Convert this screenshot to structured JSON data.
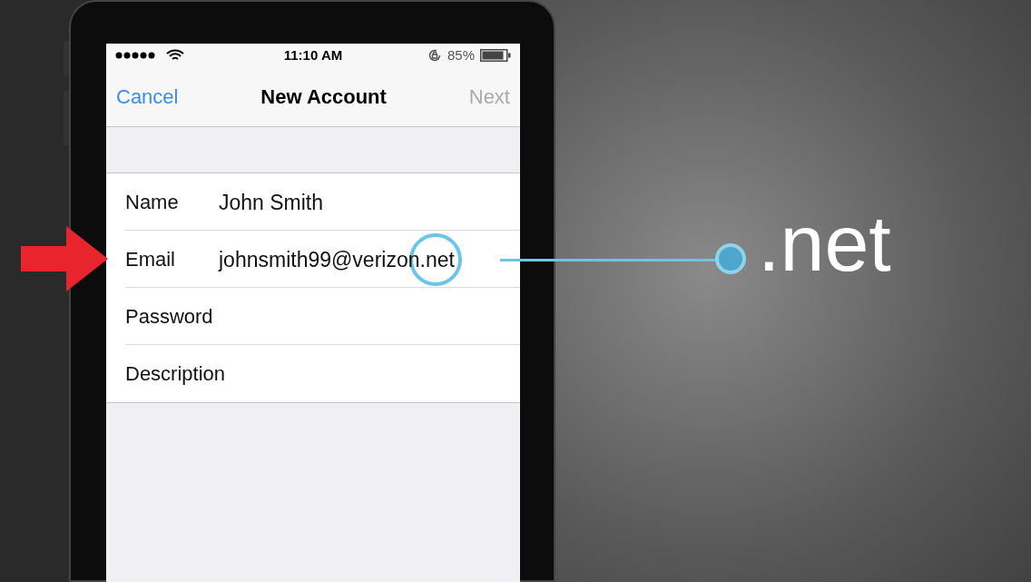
{
  "status_bar": {
    "time": "11:10 AM",
    "battery": "85%"
  },
  "nav": {
    "cancel": "Cancel",
    "title": "New Account",
    "next": {
      "label": "Next",
      "disabled": true
    }
  },
  "fields": [
    {
      "label": "Name",
      "value": "John Smith",
      "highlighted": false
    },
    {
      "label": "Email",
      "value": "johnsmith99@verizon.net",
      "highlighted": true
    },
    {
      "label": "Password",
      "highlighted": false
    },
    {
      "label": "Description",
      "highlighted": false
    }
  ],
  "callout": {
    "text": ".net"
  }
}
